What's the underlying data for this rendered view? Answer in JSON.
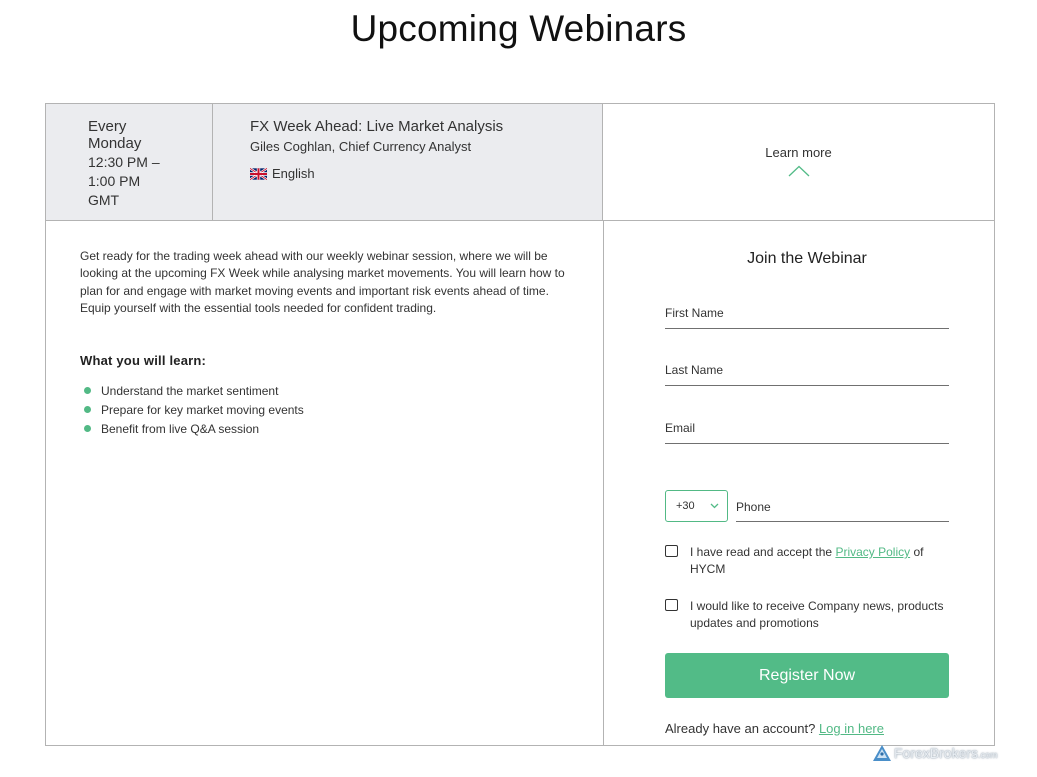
{
  "page": {
    "title": "Upcoming Webinars"
  },
  "webinar": {
    "schedule": {
      "day": "Every Monday",
      "time_range": "12:30 PM – 1:00 PM",
      "timezone": "GMT"
    },
    "title": "FX Week Ahead: Live Market Analysis",
    "presenter": "Giles Coghlan, Chief Currency Analyst",
    "language": {
      "flag_icon": "uk-flag-icon",
      "label": "English"
    },
    "learn_more_label": "Learn more",
    "description": "Get ready for the trading week ahead with our weekly webinar session, where we will be looking at the upcoming FX Week while analysing market movements. You will learn how to plan for and engage with market moving events and important risk events ahead of time. Equip yourself with the essential tools needed for confident trading.",
    "learn_heading": "What you will learn:",
    "learn_items": [
      "Understand the market sentiment",
      "Prepare for key market moving events",
      "Benefit from live Q&A session"
    ]
  },
  "form": {
    "title": "Join the Webinar",
    "first_name": {
      "placeholder": "First Name",
      "value": ""
    },
    "last_name": {
      "placeholder": "Last Name",
      "value": ""
    },
    "email": {
      "placeholder": "Email",
      "value": ""
    },
    "phone_code": "+30",
    "phone": {
      "placeholder": "Phone",
      "value": ""
    },
    "privacy_text_before": "I have read and accept the ",
    "privacy_link": "Privacy Policy",
    "privacy_text_after": " of HYCM",
    "privacy_checked": false,
    "news_text": "I would like to receive Company news, products updates and promotions",
    "news_checked": false,
    "register_label": "Register Now",
    "login_prompt": "Already have an account? ",
    "login_link": "Log in here"
  },
  "watermark": {
    "brand": "ForexBrokers",
    "suffix": ".com"
  },
  "colors": {
    "accent": "#52bb87",
    "header_bg": "#ebecef",
    "border": "#b3b3b3"
  }
}
